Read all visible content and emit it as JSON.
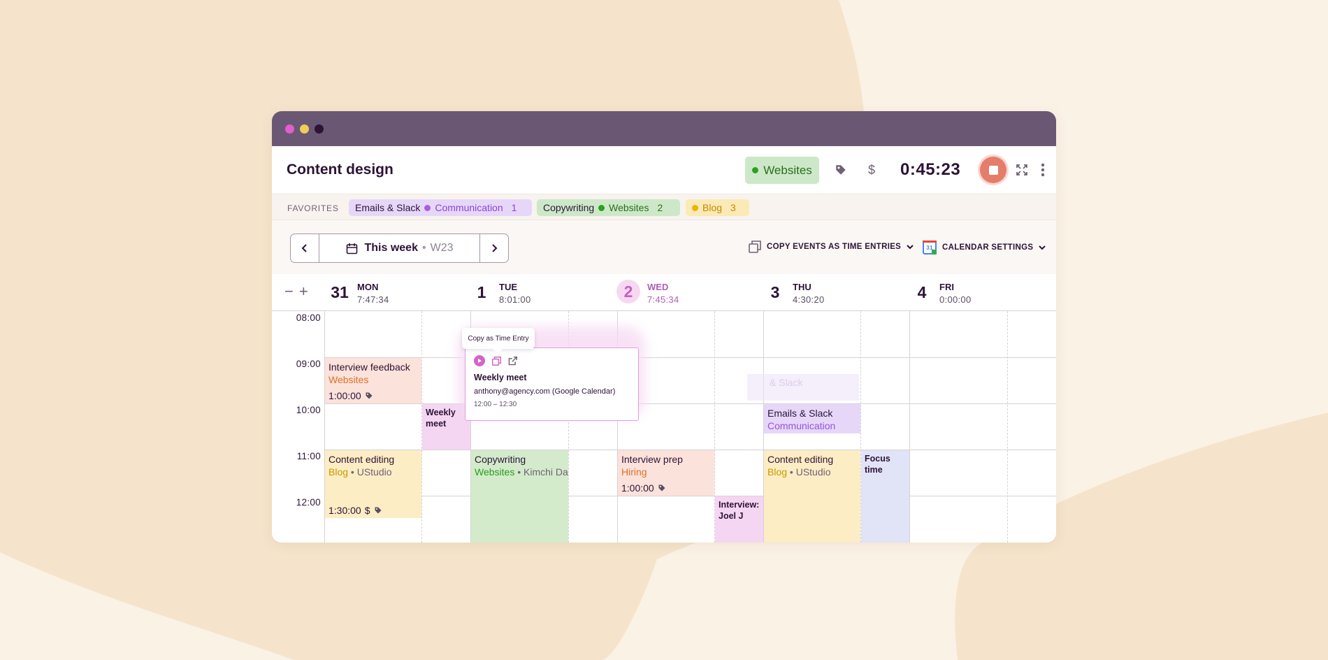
{
  "colors": {
    "background": "#FBF2E6",
    "blob": "#F5E4CB",
    "titlebar": "#6A5773",
    "accent_pink": "#D364C9",
    "stop_button": "#E57D6B"
  },
  "window": {
    "dots": [
      "pink",
      "yellow",
      "dark"
    ]
  },
  "header": {
    "title": "Content design",
    "project": {
      "label": "Websites",
      "color": "#2BA11E"
    },
    "tag_icon": "tag-icon",
    "billable_icon": "dollar-icon",
    "timer": "0:45:23",
    "stop_icon": "stop-icon",
    "expand_icon": "expand-icon",
    "more_icon": "more-vertical-icon"
  },
  "favorites": {
    "label": "FAVORITES",
    "items": [
      {
        "description": "Emails & Slack",
        "project": "Communication",
        "count": "1",
        "color": "#A75FE0"
      },
      {
        "description": "Copywriting",
        "project": "Websites",
        "count": "2",
        "color": "#2BA11E"
      },
      {
        "description": "Blog",
        "project": "",
        "count": "3",
        "color": "#E8B40D"
      }
    ]
  },
  "toolbar": {
    "week_title": "This week",
    "week_separator": "•",
    "week_number": "W23",
    "copy_events": "COPY EVENTS AS TIME ENTRIES",
    "calendar_settings": "CALENDAR SETTINGS",
    "calendar_icon_text": "31"
  },
  "zoom": {
    "minus": "−",
    "plus": "+"
  },
  "days": [
    {
      "num": "31",
      "name": "MON",
      "time": "7:47:34"
    },
    {
      "num": "1",
      "name": "TUE",
      "time": "8:01:00"
    },
    {
      "num": "2",
      "name": "WED",
      "time": "7:45:34",
      "today": true
    },
    {
      "num": "3",
      "name": "THU",
      "time": "4:30:20"
    },
    {
      "num": "4",
      "name": "FRI",
      "time": "0:00:00"
    }
  ],
  "hours": [
    "08:00",
    "09:00",
    "10:00",
    "11:00",
    "12:00"
  ],
  "events": {
    "interview_feedback": {
      "title": "Interview feedback",
      "project": "Websites",
      "duration": "1:00:00"
    },
    "weekly_meet_mon": {
      "title": "Weekly meet"
    },
    "content_editing_mon": {
      "title": "Content editing",
      "project": "Blog",
      "client": "UStudio",
      "duration": "1:30:00"
    },
    "copywriting_tue": {
      "title": "Copywriting",
      "project": "Websites",
      "client": "Kimchi Da"
    },
    "ghost_emails": {
      "title": "& Slack"
    },
    "interview_prep": {
      "title": "Interview prep",
      "project": "Hiring",
      "duration": "1:00:00"
    },
    "interview_joel": {
      "title": "Interview: Joel J"
    },
    "emails_slack_thu": {
      "title": "Emails & Slack",
      "project": "Communication"
    },
    "content_editing_thu": {
      "title": "Content editing",
      "project": "Blog",
      "client": "UStudio"
    },
    "focus_time": {
      "title": "Focus time"
    }
  },
  "popover": {
    "tooltip": "Copy as Time Entry",
    "title": "Weekly meet",
    "subtitle": "anthony@agency.com (Google Calendar)",
    "time": "12:00 – 12:30"
  }
}
